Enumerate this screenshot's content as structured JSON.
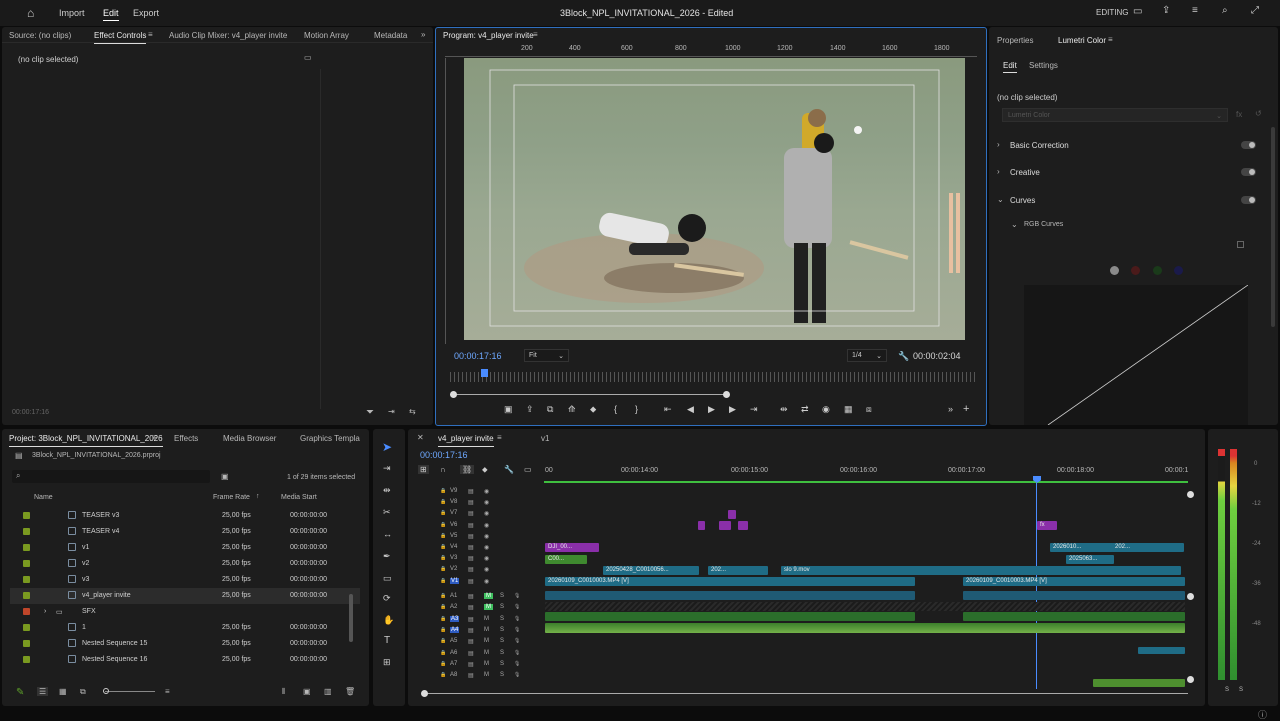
{
  "topbar": {
    "home": "home-icon",
    "import": "Import",
    "edit": "Edit",
    "export": "Export",
    "title": "3Block_NPL_INVITATIONAL_2026 - Edited",
    "workspace": "EDITING"
  },
  "source": {
    "tabs": [
      "Source: (no clips)",
      "Effect Controls",
      "Audio Clip Mixer: v4_player invite",
      "Motion Array",
      "Metadata"
    ],
    "no_clip": "(no clip selected)",
    "timecode": "00:00:17:16"
  },
  "program": {
    "tab": "Program: v4_player invite",
    "ruler": [
      "200",
      "400",
      "600",
      "800",
      "1000",
      "1200",
      "1400",
      "1600",
      "1800"
    ],
    "timecode": "00:00:17:16",
    "fit": "Fit",
    "resolution": "1/4",
    "duration": "00:00:02:04"
  },
  "lumetri": {
    "tabs": [
      "Properties",
      "Lumetri Color"
    ],
    "subtabs": [
      "Edit",
      "Settings"
    ],
    "no_clip": "(no clip selected)",
    "effect": "Lumetri Color",
    "sections": [
      "Basic Correction",
      "Creative",
      "Curves"
    ],
    "rgb": "RGB Curves"
  },
  "project": {
    "tabs": [
      "Project: 3Block_NPL_INVITATIONAL_2026",
      "Effects",
      "Media Browser",
      "Graphics Templa"
    ],
    "file": "3Block_NPL_INVITATIONAL_2026.prproj",
    "search_placeholder": "",
    "selected": "1 of 29 items selected",
    "cols": [
      "Name",
      "Frame Rate",
      "Media Start"
    ],
    "rows": [
      {
        "name": "TEASER v3",
        "rate": "25,00 fps",
        "start": "00:00:00:00",
        "color": "#7a9a20"
      },
      {
        "name": "TEASER v4",
        "rate": "25,00 fps",
        "start": "00:00:00:00",
        "color": "#7a9a20"
      },
      {
        "name": "v1",
        "rate": "25,00 fps",
        "start": "00:00:00:00",
        "color": "#7a9a20"
      },
      {
        "name": "v2",
        "rate": "25,00 fps",
        "start": "00:00:00:00",
        "color": "#7a9a20"
      },
      {
        "name": "v3",
        "rate": "25,00 fps",
        "start": "00:00:00:00",
        "color": "#7a9a20"
      },
      {
        "name": "v4_player invite",
        "rate": "25,00 fps",
        "start": "00:00:00:00",
        "color": "#7a9a20"
      },
      {
        "name": "SFX",
        "rate": "",
        "start": "",
        "color": "#c0462a"
      },
      {
        "name": "1",
        "rate": "25,00 fps",
        "start": "00:00:00:00",
        "color": "#7a9a20"
      },
      {
        "name": "Nested Sequence 15",
        "rate": "25,00 fps",
        "start": "00:00:00:00",
        "color": "#7a9a20"
      },
      {
        "name": "Nested Sequence 16",
        "rate": "25,00 fps",
        "start": "00:00:00:00",
        "color": "#7a9a20"
      }
    ]
  },
  "timeline": {
    "tab": "v4_player invite",
    "tab2": "v1",
    "timecode": "00:00:17:16",
    "ruler": [
      "00",
      "00:00:14:00",
      "00:00:15:00",
      "00:00:16:00",
      "00:00:17:00",
      "00:00:18:00",
      "00:00:1"
    ],
    "vtracks": [
      "V9",
      "V8",
      "V7",
      "V6",
      "V5",
      "V4",
      "V3",
      "V2",
      "V1"
    ],
    "atracks": [
      "A1",
      "A2",
      "A3",
      "A4",
      "A5",
      "A6",
      "A7",
      "A8"
    ],
    "clips": {
      "v4a": "DJI_00...",
      "v3a": "C00...",
      "v2a": "20250428_C0010056...",
      "v2b": "202...",
      "v2c": "slo 9.mov",
      "v1a": "20260109_C0010003.MP4 [V]",
      "v1b": "20260109_C0010003.MP4 [V]",
      "v4b": "2026010...",
      "v4c": "202...",
      "v3b": "2025063...",
      "fx": "fx"
    }
  },
  "meter": {
    "labels": [
      "S",
      "S"
    ]
  }
}
